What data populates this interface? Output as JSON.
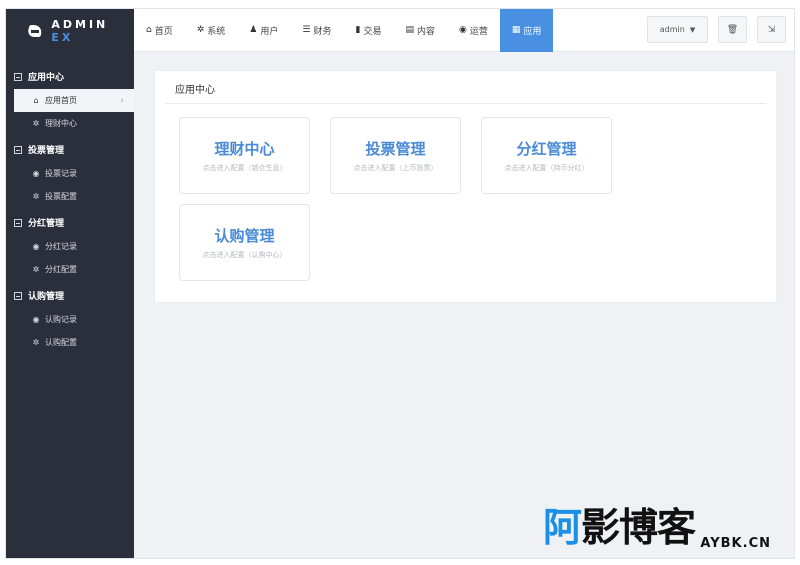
{
  "logo": {
    "text": "ADMIN",
    "suffix": "EX"
  },
  "sidebar": {
    "groups": [
      {
        "label": "应用中心",
        "items": [
          {
            "icon": "home-icon",
            "glyph": "⌂",
            "label": "应用首页",
            "active": true
          },
          {
            "icon": "gear-icon",
            "glyph": "✲",
            "label": "理财中心"
          }
        ]
      },
      {
        "label": "投票管理",
        "items": [
          {
            "icon": "globe-icon",
            "glyph": "◉",
            "label": "投票记录"
          },
          {
            "icon": "gear-icon",
            "glyph": "✲",
            "label": "投票配置"
          }
        ]
      },
      {
        "label": "分红管理",
        "items": [
          {
            "icon": "globe-icon",
            "glyph": "◉",
            "label": "分红记录"
          },
          {
            "icon": "gear-icon",
            "glyph": "✲",
            "label": "分红配置"
          }
        ]
      },
      {
        "label": "认购管理",
        "items": [
          {
            "icon": "globe-icon",
            "glyph": "◉",
            "label": "认购记录"
          },
          {
            "icon": "gear-icon",
            "glyph": "✲",
            "label": "认购配置"
          }
        ]
      }
    ]
  },
  "topnav": {
    "items": [
      {
        "label": "首页",
        "icon": "home-icon",
        "glyph": "⌂"
      },
      {
        "label": "系统",
        "icon": "gear-icon",
        "glyph": "✲"
      },
      {
        "label": "用户",
        "icon": "user-icon",
        "glyph": "♟"
      },
      {
        "label": "财务",
        "icon": "list-icon",
        "glyph": "☰"
      },
      {
        "label": "交易",
        "icon": "bar-chart-icon",
        "glyph": "▮"
      },
      {
        "label": "内容",
        "icon": "document-icon",
        "glyph": "▤"
      },
      {
        "label": "运营",
        "icon": "globe-icon",
        "glyph": "◉"
      },
      {
        "label": "应用",
        "icon": "grid-icon",
        "glyph": "▦",
        "active": true
      }
    ],
    "user": "admin",
    "trash_glyph": "🗑",
    "exit_glyph": "⇲"
  },
  "panel": {
    "title": "应用中心",
    "cards": [
      {
        "title": "理财中心",
        "desc": "点击进入配置（锁仓生息）"
      },
      {
        "title": "投票管理",
        "desc": "点击进入配置（上币投票）"
      },
      {
        "title": "分红管理",
        "desc": "点击进入配置（持币分红）"
      },
      {
        "title": "认购管理",
        "desc": "点击进入配置（认购中心）"
      }
    ]
  },
  "watermark": {
    "cn_a": "阿",
    "cn_b": "影博客",
    "en": "AYBK.CN"
  }
}
